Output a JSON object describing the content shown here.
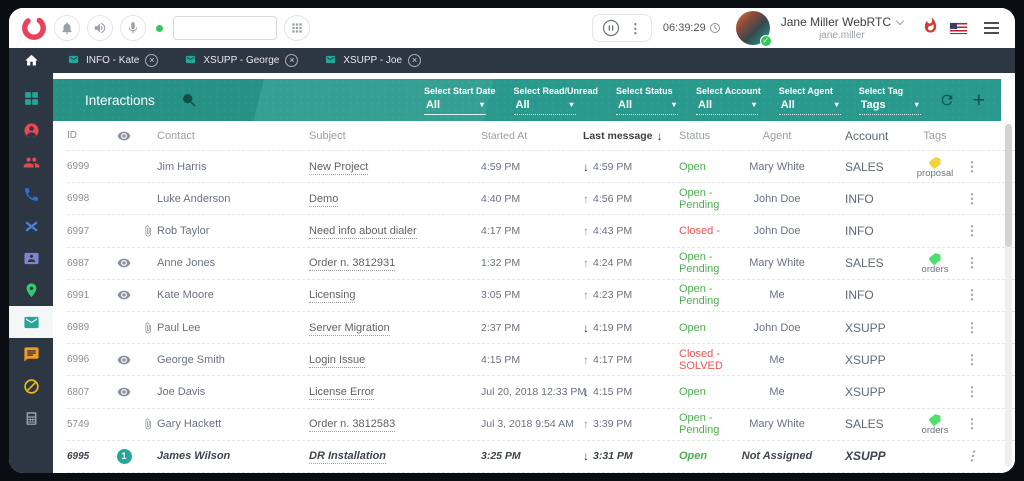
{
  "colors": {
    "teal": "#28998c",
    "sidebar_bg": "#2d3643",
    "status_open": "#4caf50",
    "status_closed": "#ef5350",
    "accent_red": "#e8435a"
  },
  "topbar": {
    "input_value": "",
    "timer": "06:39:29",
    "user": {
      "name": "Jane Miller WebRTC",
      "username": "jane.miller"
    }
  },
  "tabs": [
    {
      "label": "INFO - Kate"
    },
    {
      "label": "XSUPP - George"
    },
    {
      "label": "XSUPP - Joe"
    }
  ],
  "sidebar": {
    "items": [
      {
        "name": "dashboard",
        "icon": "dashboard-grid-icon",
        "color": "#26a69a",
        "selected": false
      },
      {
        "name": "agents",
        "icon": "agent-person-icon",
        "color": "#e5484d",
        "selected": false
      },
      {
        "name": "contacts",
        "icon": "contacts-group-icon",
        "color": "#e5484d",
        "selected": false
      },
      {
        "name": "calls",
        "icon": "phone-icon",
        "color": "#2d6fd2",
        "selected": false
      },
      {
        "name": "missed-calls",
        "icon": "crossed-phones-icon",
        "color": "#4a7fd4",
        "selected": false
      },
      {
        "name": "address-book",
        "icon": "address-book-icon",
        "color": "#7b85c8",
        "selected": false
      },
      {
        "name": "locations",
        "icon": "location-pin-icon",
        "color": "#2dce6f",
        "selected": false
      },
      {
        "name": "interactions-mail",
        "icon": "mail-icon",
        "color": "#26a69a",
        "selected": true
      },
      {
        "name": "chats",
        "icon": "chat-icon",
        "color": "#f59a23",
        "selected": false
      },
      {
        "name": "blocked",
        "icon": "blocked-circle-icon",
        "color": "#e8b71a",
        "selected": false
      },
      {
        "name": "dialer",
        "icon": "calculator-icon",
        "color": "#949ca6",
        "selected": false
      }
    ]
  },
  "panel": {
    "title": "Interactions",
    "filters": [
      {
        "label": "Select Start Date",
        "value": "All",
        "underline": "solid"
      },
      {
        "label": "Select Read/Unread",
        "value": "All",
        "underline": "dotted"
      },
      {
        "label": "Select Status",
        "value": "All",
        "underline": "dotted"
      },
      {
        "label": "Select Account",
        "value": "All",
        "underline": "dotted"
      },
      {
        "label": "Select Agent",
        "value": "All",
        "underline": "dotted"
      },
      {
        "label": "Select Tag",
        "value": "Tags",
        "underline": "dotted"
      }
    ]
  },
  "table": {
    "headers": {
      "id": "ID",
      "contact": "Contact",
      "subject": "Subject",
      "started": "Started At",
      "last": "Last message",
      "status": "Status",
      "agent": "Agent",
      "account": "Account",
      "tags": "Tags"
    },
    "rows": [
      {
        "id": "6999",
        "eye": false,
        "clip": false,
        "badge": null,
        "contact": "Jim Harris",
        "subject": "New Project",
        "started": "4:59 PM",
        "dir": "down",
        "last": "4:59 PM",
        "status": "Open",
        "tone": "open",
        "agent": "Mary White",
        "account": "SALES",
        "tag": {
          "label": "proposal",
          "color": "#f2d23d"
        },
        "unread": false
      },
      {
        "id": "6998",
        "eye": false,
        "clip": false,
        "badge": null,
        "contact": "Luke Anderson",
        "subject": "Demo",
        "started": "4:40 PM",
        "dir": "up",
        "last": "4:56 PM",
        "status": "Open - Pending",
        "tone": "open",
        "agent": "John Doe",
        "account": "INFO",
        "tag": null,
        "unread": false
      },
      {
        "id": "6997",
        "eye": false,
        "clip": true,
        "badge": null,
        "contact": "Rob Taylor",
        "subject": "Need info about dialer",
        "started": "4:17 PM",
        "dir": "up",
        "last": "4:43 PM",
        "status": "Closed -",
        "tone": "closed",
        "agent": "John Doe",
        "account": "INFO",
        "tag": null,
        "unread": false
      },
      {
        "id": "6987",
        "eye": true,
        "clip": false,
        "badge": null,
        "contact": "Anne Jones",
        "subject": "Order n. 3812931",
        "started": "1:32 PM",
        "dir": "up",
        "last": "4:24 PM",
        "status": "Open - Pending",
        "tone": "open",
        "agent": "Mary White",
        "account": "SALES",
        "tag": {
          "label": "orders",
          "color": "#4ce06d"
        },
        "unread": false
      },
      {
        "id": "6991",
        "eye": true,
        "clip": false,
        "badge": null,
        "contact": "Kate Moore",
        "subject": "Licensing",
        "started": "3:05 PM",
        "dir": "up",
        "last": "4:23 PM",
        "status": "Open - Pending",
        "tone": "open",
        "agent": "Me",
        "account": "INFO",
        "tag": null,
        "unread": false
      },
      {
        "id": "6989",
        "eye": false,
        "clip": true,
        "badge": null,
        "contact": "Paul Lee",
        "subject": "Server Migration",
        "started": "2:37 PM",
        "dir": "down",
        "last": "4:19 PM",
        "status": "Open",
        "tone": "open",
        "agent": "John Doe",
        "account": "XSUPP",
        "tag": null,
        "unread": false
      },
      {
        "id": "6996",
        "eye": true,
        "clip": false,
        "badge": null,
        "contact": "George Smith",
        "subject": "Login Issue",
        "started": "4:15 PM",
        "dir": "up",
        "last": "4:17 PM",
        "status": "Closed - SOLVED",
        "tone": "closed",
        "agent": "Me",
        "account": "XSUPP",
        "tag": null,
        "unread": false
      },
      {
        "id": "6807",
        "eye": true,
        "clip": false,
        "badge": null,
        "contact": "Joe Davis",
        "subject": "License Error",
        "started": "Jul 20, 2018 12:33 PM",
        "dir": "down",
        "last": "4:15 PM",
        "status": "Open",
        "tone": "open",
        "agent": "Me",
        "account": "XSUPP",
        "tag": null,
        "unread": false
      },
      {
        "id": "5749",
        "eye": false,
        "clip": true,
        "badge": null,
        "contact": "Gary Hackett",
        "subject": "Order n. 3812583",
        "started": "Jul 3, 2018 9:54 AM",
        "dir": "up",
        "last": "3:39 PM",
        "status": "Open - Pending",
        "tone": "open",
        "agent": "Mary White",
        "account": "SALES",
        "tag": {
          "label": "orders",
          "color": "#4ce06d"
        },
        "unread": false
      },
      {
        "id": "6995",
        "eye": false,
        "clip": false,
        "badge": "1",
        "contact": "James Wilson",
        "subject": "DR Installation",
        "started": "3:25 PM",
        "dir": "down",
        "last": "3:31 PM",
        "status": "Open",
        "tone": "open",
        "agent": "Not Assigned",
        "account": "XSUPP",
        "tag": null,
        "unread": true
      }
    ]
  }
}
